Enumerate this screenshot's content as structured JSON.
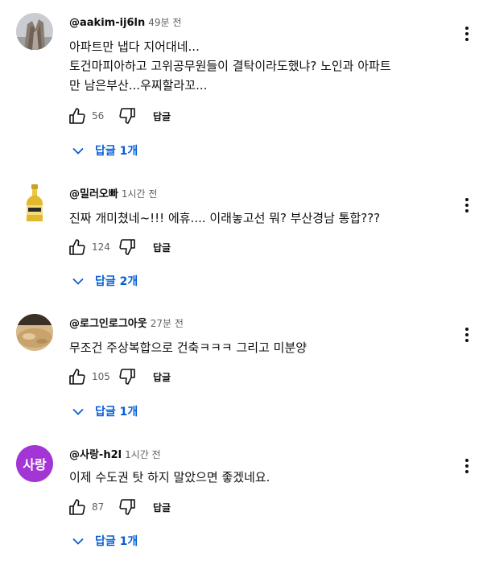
{
  "comments": [
    {
      "author": "@aakim-ij6ln",
      "time": "49분 전",
      "text_lines": [
        "아파트만 냅다 지어대네...",
        "토건마피아하고 고위공무원들이 결탁이라도했냐? 노인과 아파트",
        "만 남은부산...우찌할라꼬..."
      ],
      "likes": "56",
      "reply_label": "답글",
      "replies_label": "답글 1개",
      "avatar_icon": "rock-landscape-photo"
    },
    {
      "author": "@밀러오빠",
      "time": "1시간 전",
      "text_lines": [
        "진짜 개미쳤네~!!! 에휴.... 이래놓고선 뭐? 부산경남 통합???"
      ],
      "likes": "124",
      "reply_label": "답글",
      "replies_label": "답글 2개",
      "avatar_icon": "beer-bottle"
    },
    {
      "author": "@로그인로그아웃",
      "time": "27분 전",
      "text_lines": [
        "무조건 주상복합으로 건축ㅋㅋㅋ 그리고 미분양"
      ],
      "likes": "105",
      "reply_label": "답글",
      "replies_label": "답글 1개",
      "avatar_icon": "sandy-photo"
    },
    {
      "author": "@사랑-h2l",
      "time": "1시간 전",
      "text_lines": [
        "이제 수도권 탓 하지 말았으면 좋겠네요."
      ],
      "likes": "87",
      "reply_label": "답글",
      "replies_label": "답글 1개",
      "avatar_text": "사랑",
      "avatar_color": "#a335d4"
    }
  ],
  "colors": {
    "link_blue": "#065fd4",
    "secondary_text": "#606060",
    "primary_text": "#0f0f0f"
  }
}
